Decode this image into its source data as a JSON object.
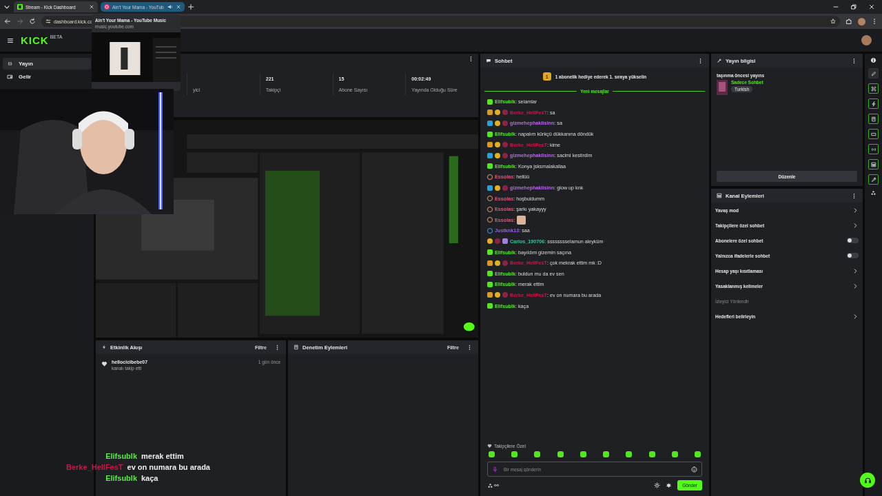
{
  "browser": {
    "tabs": [
      {
        "title": "Stream - Kick Dashboard",
        "selected": true,
        "hovered": false,
        "audio": false
      },
      {
        "title": "Ain't Your Mama - YouTub",
        "selected": false,
        "hovered": true,
        "audio": true
      }
    ],
    "address": "dashboard.kick.co",
    "tab_preview": {
      "title": "Ain't Your Mama - YouTube Music",
      "url": "music.youtube.com"
    }
  },
  "header": {
    "logo": "KICK",
    "logo_tag": "BETA"
  },
  "sidebar": {
    "items": [
      {
        "label": "Yayın",
        "selected": true
      },
      {
        "label": "Gelir",
        "selected": false
      }
    ]
  },
  "stats": [
    {
      "label": "yici"
    },
    {
      "value": "221",
      "label": "Takipçi"
    },
    {
      "value": "15",
      "label": "Abone Sayısı"
    },
    {
      "value": "00:02:49",
      "label": "Yayında Olduğu Süre"
    }
  ],
  "activity": {
    "title": "Etkinlik Akışı",
    "filter": "Filtre",
    "events": [
      {
        "user": "hellocicibebe07",
        "action": "kanalı takip etti",
        "time": "1 gün önce"
      }
    ]
  },
  "moderation": {
    "title": "Denetim Eylemleri",
    "filter": "Filtre"
  },
  "chat": {
    "title": "Sohbet",
    "pinned_badge": "1",
    "pinned": "1 abonelik hediye ederek 1. sıraya yükselin",
    "divider": "Yeni mesajlar",
    "separator": ":",
    "messages": [
      {
        "kind": "text",
        "user": "Elifsublk",
        "color": "#53e81e",
        "badges": [
          {
            "kind": "sub"
          }
        ],
        "text": "selamlar"
      },
      {
        "kind": "text",
        "user": "Berke_HellFesT",
        "color": "#c8174a",
        "badges": [
          {
            "kind": "crown"
          },
          {
            "kind": "coin"
          },
          {
            "kind": "dot"
          }
        ],
        "text": "sa"
      },
      {
        "kind": "text",
        "user": "gizmehephaklisinn",
        "color": "#b46ce0",
        "badges": [
          {
            "kind": "mod"
          },
          {
            "kind": "coin"
          },
          {
            "kind": "dot"
          }
        ],
        "text": "sa"
      },
      {
        "kind": "text",
        "user": "Elifsublk",
        "color": "#53e81e",
        "badges": [
          {
            "kind": "sub"
          }
        ],
        "text": "napalım kürkçü dükkanına döndük"
      },
      {
        "kind": "text",
        "user": "Berke_HellFesT",
        "color": "#c8174a",
        "badges": [
          {
            "kind": "crown"
          },
          {
            "kind": "coin"
          },
          {
            "kind": "dot"
          }
        ],
        "text": "kime"
      },
      {
        "kind": "text",
        "user": "gizmehephaklisinn",
        "color": "#b46ce0",
        "badges": [
          {
            "kind": "mod"
          },
          {
            "kind": "coin"
          },
          {
            "kind": "dot"
          }
        ],
        "text": "sacimi kestirdim"
      },
      {
        "kind": "text",
        "user": "Elifsublk",
        "color": "#53e81e",
        "badges": [
          {
            "kind": "sub"
          }
        ],
        "text": "Konya jsksmalakallaa"
      },
      {
        "kind": "text",
        "user": "Essolas",
        "color": "#e0567c",
        "badges": [
          {
            "kind": "ring"
          }
        ],
        "text": "hellüü"
      },
      {
        "kind": "text",
        "user": "gizmehephaklisinn",
        "color": "#b46ce0",
        "badges": [
          {
            "kind": "mod"
          },
          {
            "kind": "coin"
          },
          {
            "kind": "dot"
          }
        ],
        "text": "glow up knk"
      },
      {
        "kind": "text",
        "user": "Essolas",
        "color": "#e0567c",
        "badges": [
          {
            "kind": "ring"
          }
        ],
        "text": "hoşbuldumm"
      },
      {
        "kind": "text",
        "user": "Essolas",
        "color": "#e0567c",
        "badges": [
          {
            "kind": "ring"
          }
        ],
        "text": "şarkı yakayyy"
      },
      {
        "kind": "emote",
        "user": "Essolas",
        "color": "#e0567c",
        "badges": [
          {
            "kind": "ring"
          }
        ]
      },
      {
        "kind": "text",
        "user": "Justknk13",
        "color": "#9b5cf0",
        "badges": [
          {
            "kind": "target"
          }
        ],
        "text": "saa"
      },
      {
        "kind": "text",
        "user": "Carlos_190706",
        "color": "#2ec99a",
        "badges": [
          {
            "kind": "coin"
          },
          {
            "kind": "dot"
          },
          {
            "kind": "gift"
          }
        ],
        "text": "sssssssselamun aleyküm"
      },
      {
        "kind": "text",
        "user": "Elifsublk",
        "color": "#53e81e",
        "badges": [
          {
            "kind": "sub"
          }
        ],
        "text": "bayıldım gizemin saçına"
      },
      {
        "kind": "text",
        "user": "Berke_HellFesT",
        "color": "#c8174a",
        "badges": [
          {
            "kind": "crown"
          },
          {
            "kind": "coin"
          },
          {
            "kind": "dot"
          }
        ],
        "text": "çok mekrak ettim mk :D"
      },
      {
        "kind": "text",
        "user": "Elifsublk",
        "color": "#53e81e",
        "badges": [
          {
            "kind": "sub"
          }
        ],
        "text": "buldun mu da ev sen"
      },
      {
        "kind": "text",
        "user": "Elifsublk",
        "color": "#53e81e",
        "badges": [
          {
            "kind": "sub"
          }
        ],
        "text": "merak ettim"
      },
      {
        "kind": "text",
        "user": "Berke_HellFesT",
        "color": "#c8174a",
        "badges": [
          {
            "kind": "crown"
          },
          {
            "kind": "coin"
          },
          {
            "kind": "dot"
          }
        ],
        "text": "ev on numara bu arada"
      },
      {
        "kind": "text",
        "user": "Elifsublk",
        "color": "#53e81e",
        "badges": [
          {
            "kind": "sub"
          }
        ],
        "text": "kaça"
      }
    ],
    "emote_label": "Takipçilere Özel",
    "placeholder": "Bir mesaj gönderin",
    "send": "Gönder"
  },
  "stream_info": {
    "title": "Yayın bilgisi",
    "stream_title": "taşınma öncesi yayıns",
    "category": "Sadece Sohbet",
    "tag": "Turkish",
    "edit": "Düzenle"
  },
  "channel_actions": {
    "title": "Kanal Eylemleri",
    "items": [
      {
        "label": "Yavaş mod",
        "kind": "link",
        "disabled": false
      },
      {
        "label": "Takipçilere özel sohbet",
        "kind": "link",
        "disabled": false
      },
      {
        "label": "Abonelere özel sohbet",
        "kind": "toggle",
        "on": false,
        "disabled": false
      },
      {
        "label": "Yalnızca ifadelerle sohbet",
        "kind": "toggle",
        "on": false,
        "disabled": false
      },
      {
        "label": "Hesap yaşı kısıtlaması",
        "kind": "link",
        "disabled": false
      },
      {
        "label": "Yasaklanmış kelimeler",
        "kind": "link",
        "disabled": false
      },
      {
        "label": "İzleyici Yönlendir",
        "kind": "plain",
        "disabled": true
      },
      {
        "label": "Hedefleri belirleyin",
        "kind": "link",
        "disabled": false
      }
    ]
  },
  "overlay_chat": [
    {
      "user": "Elifsublk",
      "color": "#5ee84a",
      "text": "merak ettim"
    },
    {
      "user": "Berke_HellFesT",
      "color": "#c8174a",
      "text": "ev on numara bu arada"
    },
    {
      "user": "Elifsublk",
      "color": "#5ee84a",
      "text": "kaça"
    }
  ]
}
